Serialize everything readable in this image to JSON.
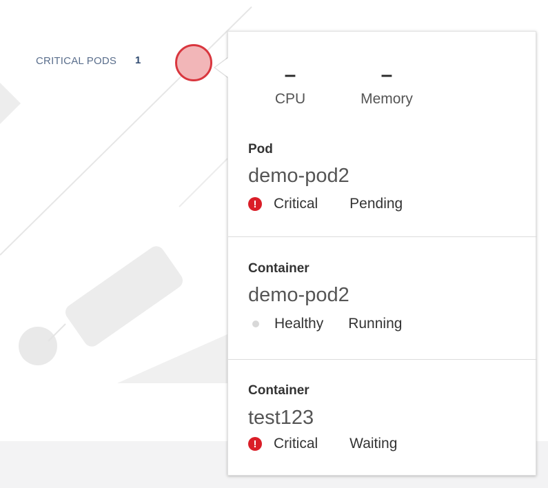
{
  "topology": {
    "label": "CRITICAL PODS",
    "count": "1"
  },
  "colors": {
    "critical": "#da1e28",
    "node_fill": "#f2b6b8",
    "label": "#5a6e8c"
  },
  "card": {
    "metrics": [
      {
        "value": "–",
        "label": "CPU"
      },
      {
        "value": "–",
        "label": "Memory"
      }
    ],
    "sections": [
      {
        "type": "Pod",
        "name": "demo-pod2",
        "health": "Critical",
        "phase": "Pending",
        "icon": "critical-icon"
      },
      {
        "type": "Container",
        "name": "demo-pod2",
        "health": "Healthy",
        "phase": "Running",
        "icon": "healthy-dot-icon"
      },
      {
        "type": "Container",
        "name": "test123",
        "health": "Critical",
        "phase": "Waiting",
        "icon": "critical-icon"
      }
    ]
  }
}
